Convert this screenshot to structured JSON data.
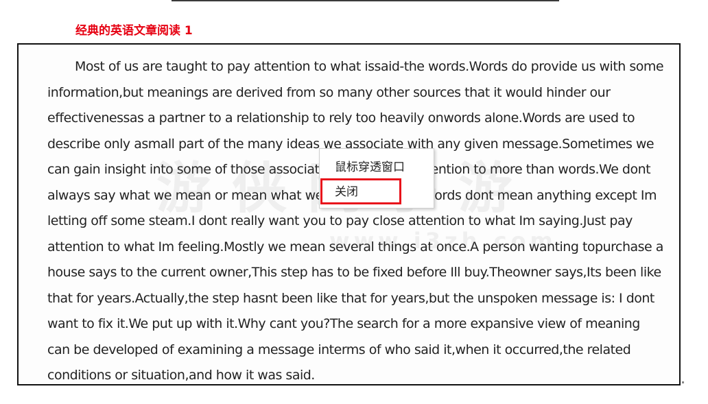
{
  "page": {
    "heading": "经典的英语文章阅读 1"
  },
  "article": {
    "text": "Most of us are taught to pay attention to what issaid-the words.Words do provide us with some information,but meanings are derived from so many other sources that it would hinder our effectivenessas a partner to a relationship to rely too heavily onwords alone.Words are used to describe only asmall part of the many ideas we associate with any given message.Sometimes we can gain insight into some of those associations by paying attention to more than words.We dont always say what we mean or mean what we say.Sometimes words dont mean anything except Im letting off some steam.I dont really want you to pay close attention to what Im saying.Just pay attention to what Im feeling.Mostly we mean several things at once.A person wanting topurchase a house says to the current owner,This step has to be fixed before Ill buy.Theowner says,Its been like that for years.Actually,the step hasnt been like that for years,but the unspoken message is: I dont want to fix it.We put up with it.Why cant you?The search for a more expansive view of meaning can be developed of examining a message interms of who said it,when it occurred,the related conditions or situation,and how it was said."
  },
  "watermark": {
    "text": "游侠网手游",
    "url": "www.i3zh.com"
  },
  "context_menu": {
    "items": [
      {
        "label": "鼠标穿透窗口"
      },
      {
        "label": "关闭"
      }
    ],
    "highlight_color": "#e8121b"
  },
  "colors": {
    "heading": "#e60012",
    "border": "#111111",
    "text": "#222222"
  }
}
